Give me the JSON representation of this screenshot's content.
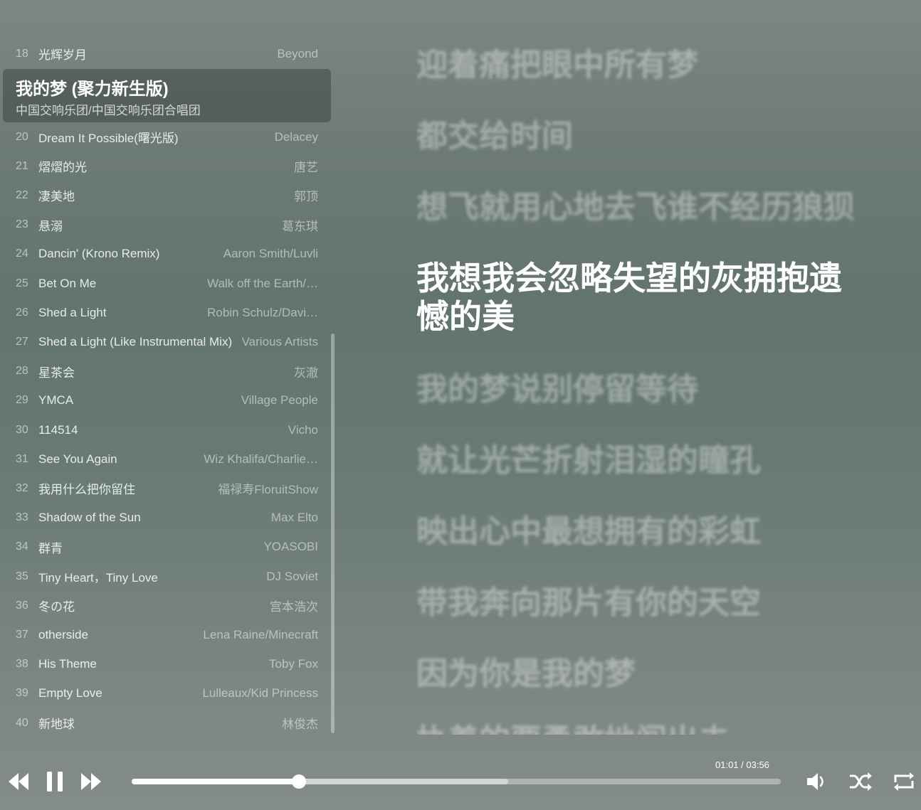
{
  "playlist": {
    "rows_before": [
      {
        "num": "18",
        "title": "光辉岁月",
        "artist": "Beyond"
      }
    ],
    "current": {
      "title": "我的梦 (聚力新生版)",
      "artist": "中国交响乐团/中国交响乐团合唱团"
    },
    "rows_after": [
      {
        "num": "20",
        "title": "Dream It Possible(曙光版)",
        "artist": "Delacey"
      },
      {
        "num": "21",
        "title": "熠熠的光",
        "artist": "唐艺"
      },
      {
        "num": "22",
        "title": "凄美地",
        "artist": "郭顶"
      },
      {
        "num": "23",
        "title": "悬溺",
        "artist": "葛东琪"
      },
      {
        "num": "24",
        "title": "Dancin' (Krono Remix)",
        "artist": "Aaron Smith/Luvli"
      },
      {
        "num": "25",
        "title": "Bet On Me",
        "artist": "Walk off the Earth/…"
      },
      {
        "num": "26",
        "title": "Shed a Light",
        "artist": "Robin Schulz/Davi…"
      },
      {
        "num": "27",
        "title": "Shed a Light (Like Instrumental Mix)",
        "artist": "Various Artists"
      },
      {
        "num": "28",
        "title": "星茶会",
        "artist": "灰澈"
      },
      {
        "num": "29",
        "title": "YMCA",
        "artist": "Village People"
      },
      {
        "num": "30",
        "title": "114514",
        "artist": "Vicho"
      },
      {
        "num": "31",
        "title": "See You Again",
        "artist": "Wiz Khalifa/Charlie…"
      },
      {
        "num": "32",
        "title": "我用什么把你留住",
        "artist": "福禄寿FloruitShow"
      },
      {
        "num": "33",
        "title": "Shadow of the Sun",
        "artist": "Max Elto"
      },
      {
        "num": "34",
        "title": "群青",
        "artist": "YOASOBI"
      },
      {
        "num": "35",
        "title": "Tiny Heart，Tiny Love",
        "artist": "DJ Soviet"
      },
      {
        "num": "36",
        "title": "冬の花",
        "artist": "宫本浩次"
      },
      {
        "num": "37",
        "title": "otherside",
        "artist": "Lena Raine/Minecraft"
      },
      {
        "num": "38",
        "title": "His Theme",
        "artist": "Toby Fox"
      },
      {
        "num": "39",
        "title": "Empty Love",
        "artist": "Lulleaux/Kid Princess"
      },
      {
        "num": "40",
        "title": "新地球",
        "artist": "林俊杰"
      }
    ]
  },
  "lyrics": {
    "lines": [
      "迎着痛把眼中所有梦",
      "都交给时间",
      "想飞就用心地去飞谁不经历狼狈",
      "我想我会忽略失望的灰拥抱遗憾的美",
      "我的梦说别停留等待",
      "就让光芒折射泪湿的瞳孔",
      "映出心中最想拥有的彩虹",
      "带我奔向那片有你的天空",
      "因为你是我的梦",
      "执着的要勇敢地闯出去"
    ],
    "current_index": 3
  },
  "player": {
    "time_text": "01:01 / 03:56",
    "progress": 0.258,
    "buffered": 0.58,
    "icons": [
      "previous-icon",
      "pause-icon",
      "next-icon",
      "volume-icon",
      "shuffle-icon",
      "repeat-icon"
    ]
  }
}
